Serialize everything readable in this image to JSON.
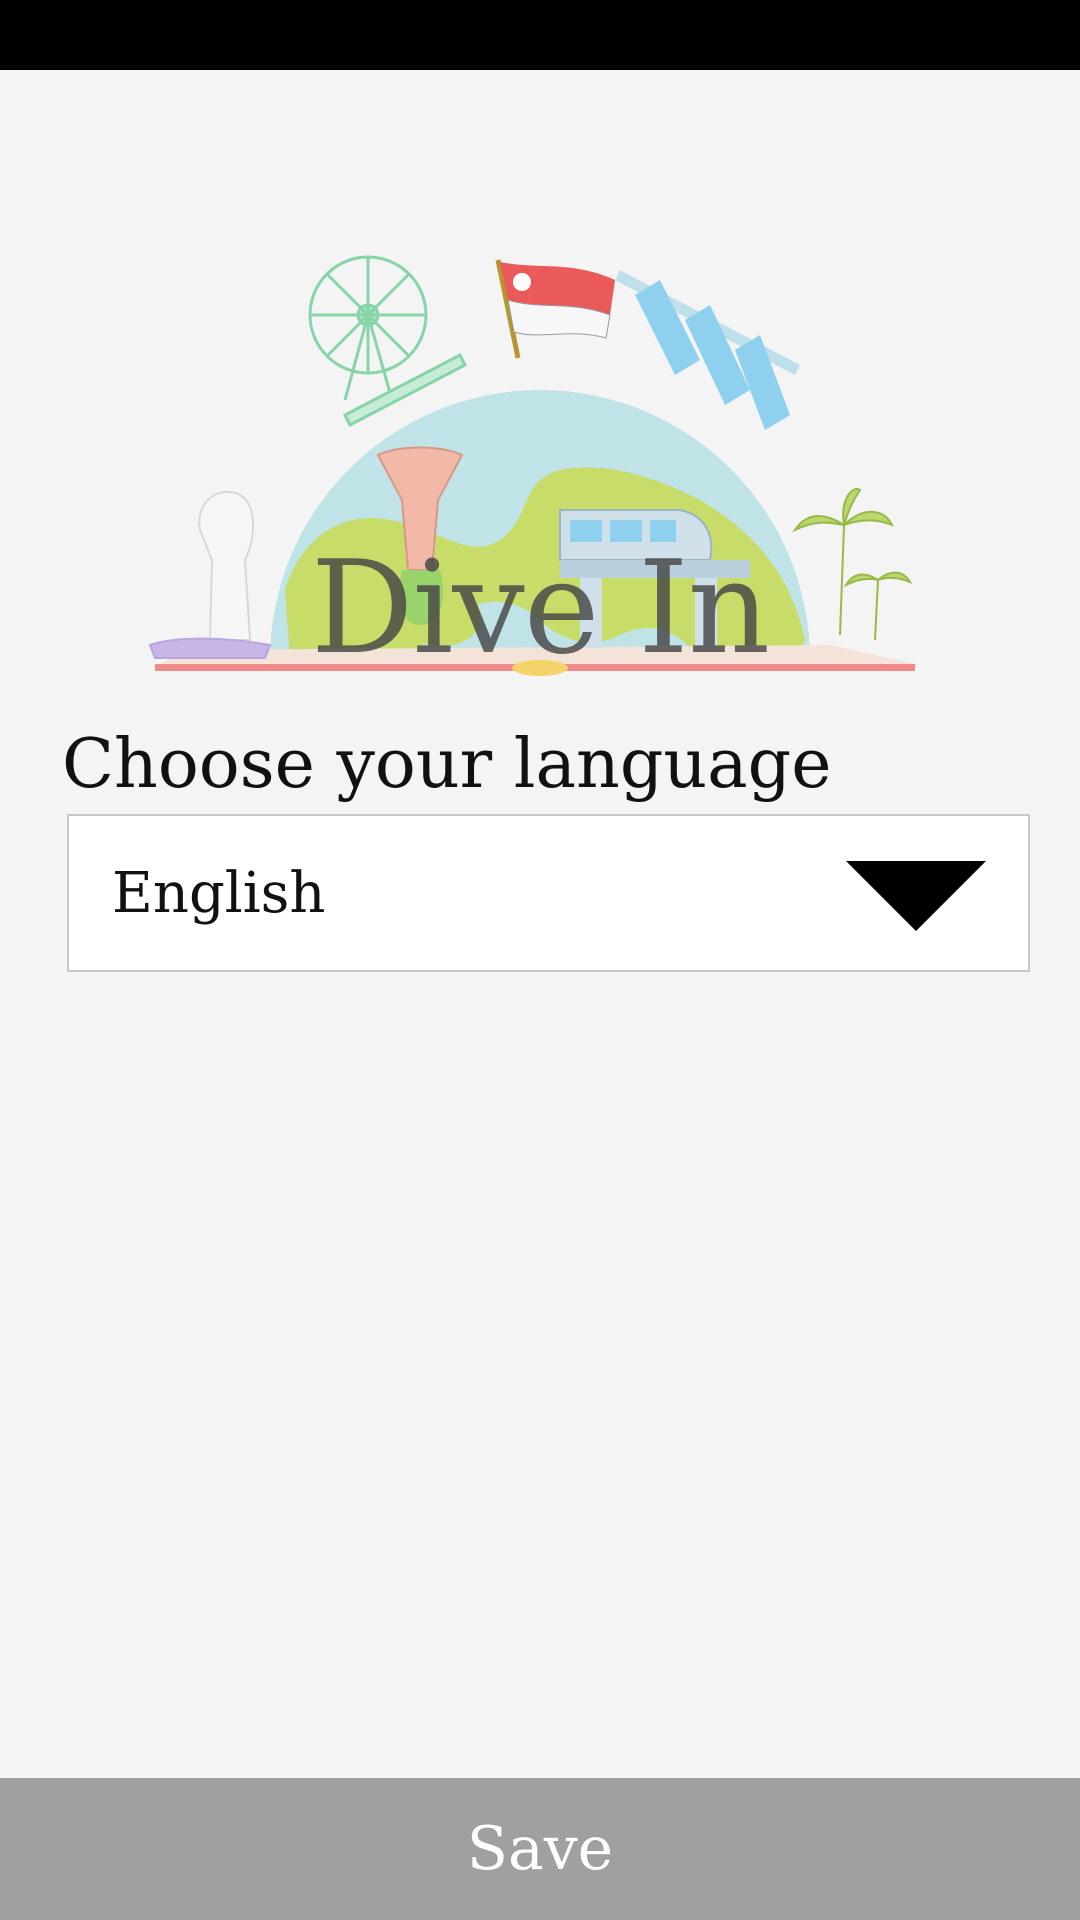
{
  "app": {
    "title": "Dive In"
  },
  "hero": {
    "illustration": "singapore-landmarks-illustration",
    "colors": {
      "globe_green": "#c8dc6a",
      "globe_water": "#bfe3e6",
      "flag_red": "#ea5a5a",
      "ground": "#f3e3d8",
      "ground_line": "#f08a8a"
    }
  },
  "language": {
    "heading": "Choose your language",
    "selected": "English",
    "arrow_icon": "triangle-down-icon"
  },
  "actions": {
    "save_label": "Save"
  },
  "colors": {
    "background": "#f4f4f4",
    "status_bar": "#000000",
    "save_bar": "#a0a0a0"
  }
}
